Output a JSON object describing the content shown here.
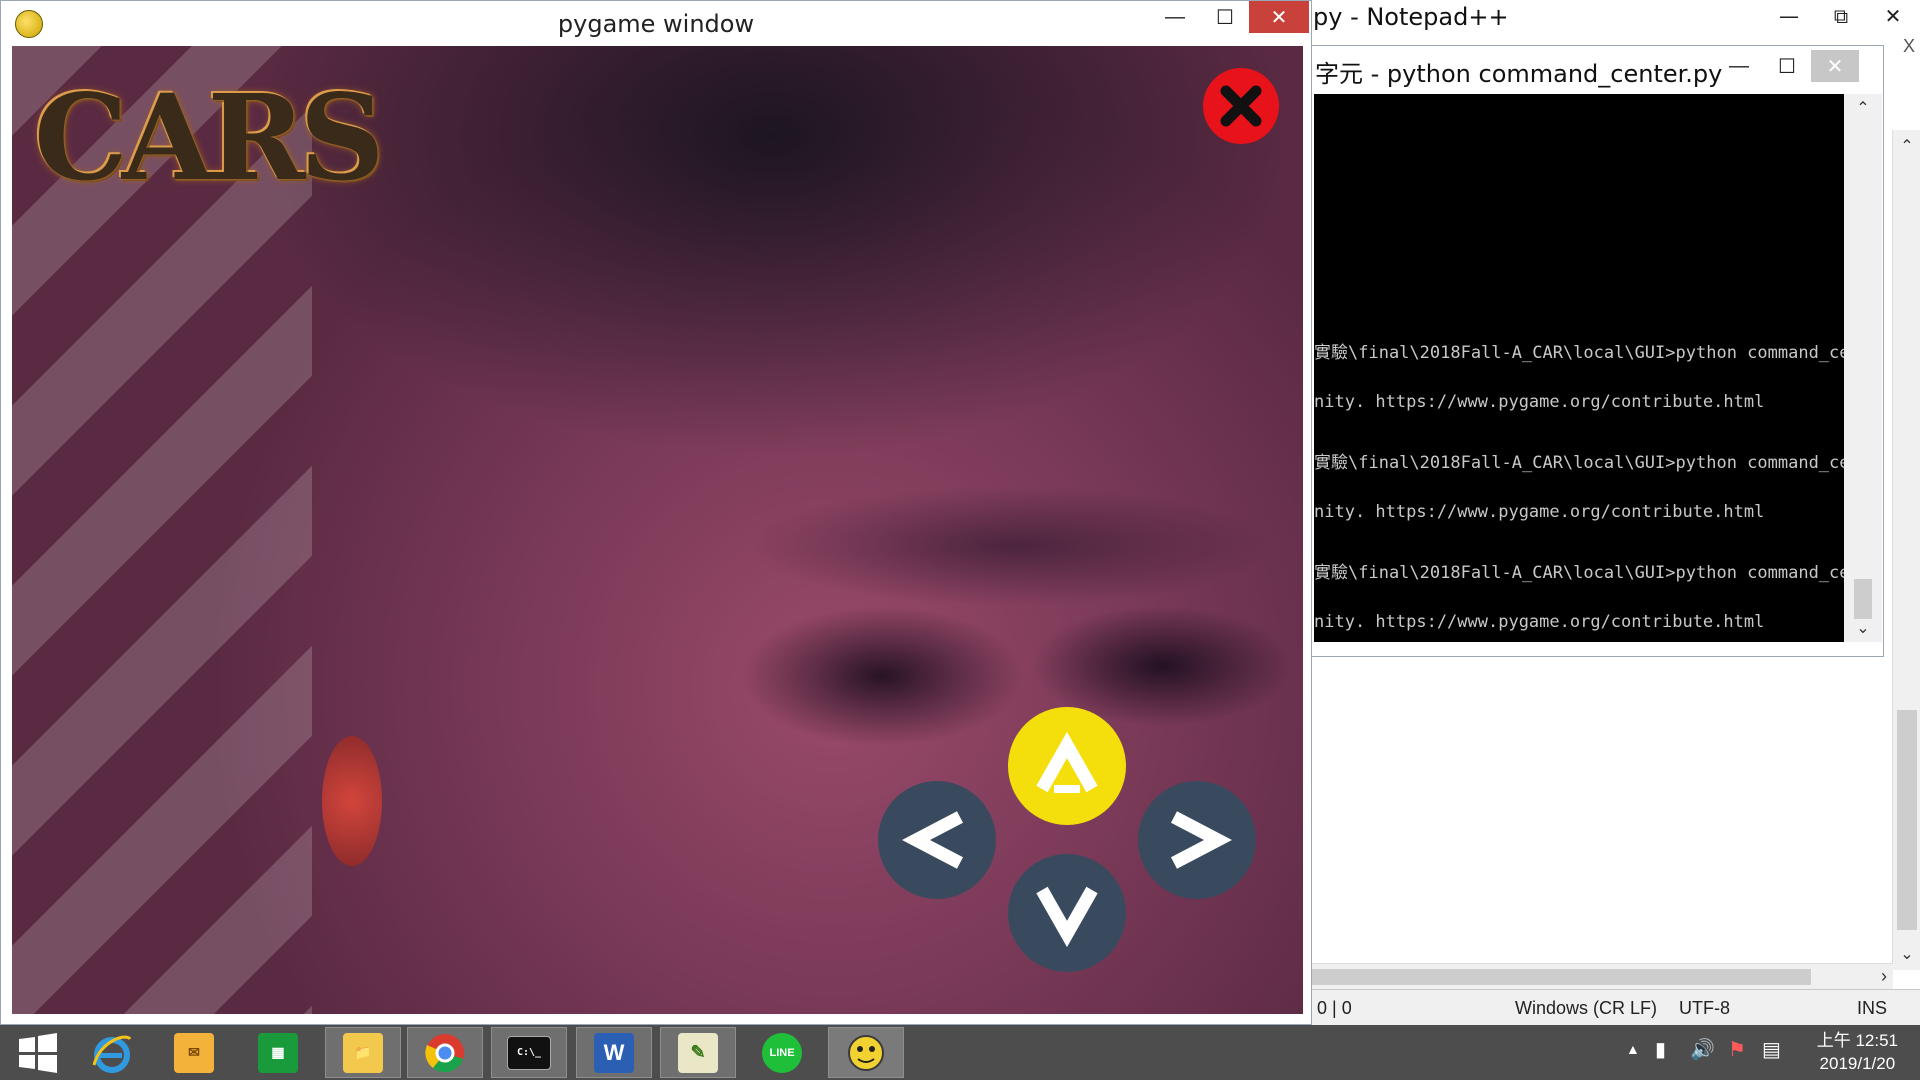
{
  "notepad": {
    "title": "py - Notepad++",
    "side_close": "X",
    "status": {
      "position": ": 0 | 0",
      "eol": "Windows (CR LF)",
      "encoding": "UTF-8",
      "mode": "INS"
    }
  },
  "console": {
    "title": "字元 - python  command_center.py",
    "lines": [
      "實驗\\final\\2018Fall-A_CAR\\local\\GUI>python command_cen",
      "nity. https://www.pygame.org/contribute.html",
      "實驗\\final\\2018Fall-A_CAR\\local\\GUI>python command_cen",
      "nity. https://www.pygame.org/contribute.html",
      "實驗\\final\\2018Fall-A_CAR\\local\\GUI>python command_cen",
      "nity. https://www.pygame.org/contribute.html"
    ]
  },
  "pygame": {
    "title": "pygame window",
    "logo_text": "CARS"
  },
  "taskbar": {
    "clock_time": "上午 12:51",
    "clock_date": "2019/1/20",
    "line_label": "LINE"
  },
  "icons": {
    "start": "windows-logo-icon",
    "ie": "internet-explorer-icon",
    "outlook": "outlook-icon",
    "store": "store-icon",
    "explorer": "file-explorer-icon",
    "chrome": "chrome-icon",
    "cmd": "command-prompt-icon",
    "word": "word-icon",
    "notepadpp": "notepad-plus-plus-icon",
    "line": "line-app-icon",
    "pygame": "pygame-icon"
  },
  "colors": {
    "close_button": "#e8121a",
    "up_button": "#f4de0c",
    "dir_button": "#3a4a5e",
    "taskbar": "#4d4d4d"
  }
}
